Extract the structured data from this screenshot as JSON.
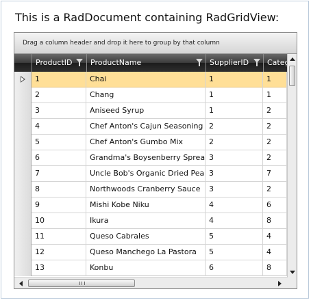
{
  "document": {
    "title": "This is a RadDocument containing RadGridView:"
  },
  "grid": {
    "group_hint": "Drag a column header and drop it here to group by that column",
    "columns": [
      {
        "label": "ProductID",
        "filter_icon": "filter-icon"
      },
      {
        "label": "ProductName",
        "filter_icon": "filter-icon"
      },
      {
        "label": "SupplierID",
        "filter_icon": "filter-icon"
      },
      {
        "label": "Categ"
      }
    ],
    "selected_row": 0,
    "rows": [
      {
        "id": "1",
        "name": "Chai",
        "supplier": "1",
        "cat": "1"
      },
      {
        "id": "2",
        "name": "Chang",
        "supplier": "1",
        "cat": "1"
      },
      {
        "id": "3",
        "name": "Aniseed Syrup",
        "supplier": "1",
        "cat": "2"
      },
      {
        "id": "4",
        "name": "Chef Anton's Cajun Seasoning",
        "supplier": "2",
        "cat": "2"
      },
      {
        "id": "5",
        "name": "Chef Anton's Gumbo Mix",
        "supplier": "2",
        "cat": "2"
      },
      {
        "id": "6",
        "name": "Grandma's Boysenberry Spread",
        "supplier": "3",
        "cat": "2"
      },
      {
        "id": "7",
        "name": "Uncle Bob's Organic Dried Pears",
        "supplier": "3",
        "cat": "7"
      },
      {
        "id": "8",
        "name": "Northwoods Cranberry Sauce",
        "supplier": "3",
        "cat": "2"
      },
      {
        "id": "9",
        "name": "Mishi Kobe Niku",
        "supplier": "4",
        "cat": "6"
      },
      {
        "id": "10",
        "name": "Ikura",
        "supplier": "4",
        "cat": "8"
      },
      {
        "id": "11",
        "name": "Queso Cabrales",
        "supplier": "5",
        "cat": "4"
      },
      {
        "id": "12",
        "name": "Queso Manchego La Pastora",
        "supplier": "5",
        "cat": "4"
      },
      {
        "id": "13",
        "name": "Konbu",
        "supplier": "6",
        "cat": "8"
      }
    ]
  },
  "colors": {
    "selection": "#ffdf97",
    "header": "#2e2e2e"
  }
}
